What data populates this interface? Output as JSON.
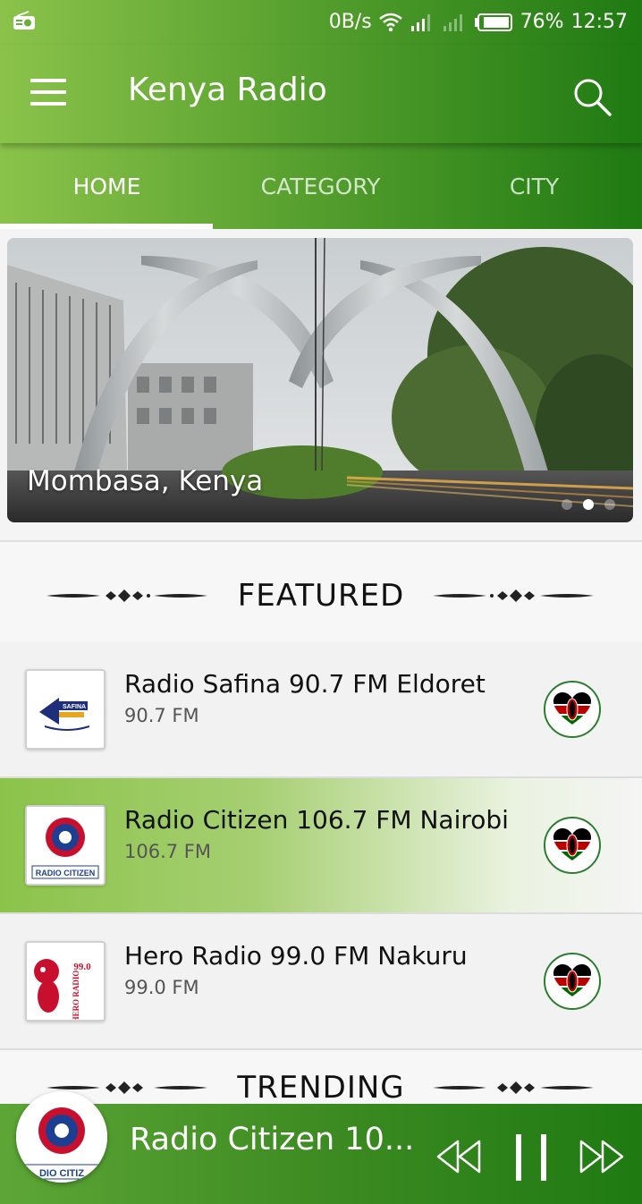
{
  "status_bar": {
    "speed": "0B/s",
    "battery": "76%",
    "time": "12:57",
    "icons": [
      "radio-notification-icon",
      "wifi-icon",
      "signal-icon",
      "signal-icon-2",
      "battery-icon"
    ]
  },
  "app_bar": {
    "title": "Kenya Radio",
    "menu_icon": "hamburger-menu-icon",
    "search_icon": "search-icon"
  },
  "tabs": [
    {
      "label": "HOME",
      "active": true
    },
    {
      "label": "CATEGORY",
      "active": false
    },
    {
      "label": "CITY",
      "active": false
    }
  ],
  "banner": {
    "caption": "Mombasa, Kenya",
    "slide_count": 3,
    "active_slide": 2
  },
  "sections": {
    "featured_title": "FEATURED",
    "trending_title": "TRENDING"
  },
  "stations": [
    {
      "name": "Radio Safina 90.7 FM Eldoret",
      "frequency": "90.7 FM",
      "logo_text": "SAFINA",
      "active": false
    },
    {
      "name": "Radio Citizen 106.7 FM Nairobi",
      "frequency": "106.7 FM",
      "logo_text": "RADIO CITIZEN",
      "active": true
    },
    {
      "name": "Hero Radio 99.0 FM Nakuru",
      "frequency": "99.0 FM",
      "logo_text": "HERO RADIO",
      "active": false
    }
  ],
  "player": {
    "now_playing": "Radio Citizen 10...",
    "logo_text": "DIO CITIZ",
    "controls": [
      "rewind-icon",
      "pause-icon",
      "fast-forward-icon"
    ]
  },
  "colors": {
    "green_light": "#8bc34a",
    "green_dark": "#1f7a12",
    "kenya_red": "#bb0000",
    "kenya_green": "#006600"
  }
}
